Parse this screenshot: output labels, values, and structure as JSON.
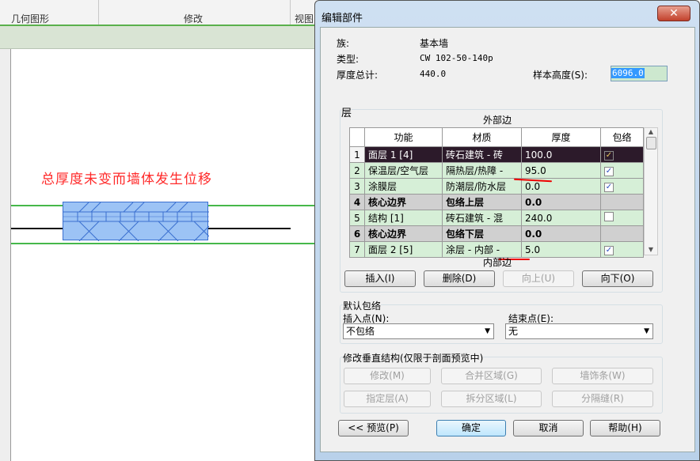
{
  "ribbon": {
    "panels": [
      "几何图形",
      "修改",
      "视图"
    ]
  },
  "canvas": {
    "annotation": "总厚度未变而墙体发生位移"
  },
  "dialog": {
    "title": "编辑部件",
    "close_icon": "close-icon",
    "family_label": "族:",
    "family_value": "基本墙",
    "type_label": "类型:",
    "type_value": "CW 102-50-140p",
    "total_label": "厚度总计:",
    "total_value": "440.0",
    "sample_label": "样本高度(S):",
    "sample_value": "6096.0",
    "layers_group": "层",
    "exterior": "外部边",
    "interior": "内部边",
    "columns": [
      "功能",
      "材质",
      "厚度",
      "包络"
    ],
    "rows": [
      {
        "n": "1",
        "func": "面层 1 [4]",
        "mat": "砖石建筑 - 砖",
        "thk": "100.0",
        "wrap": true
      },
      {
        "n": "2",
        "func": "保温层/空气层",
        "mat": "隔热层/热障 -",
        "thk": "95.0",
        "wrap": true
      },
      {
        "n": "3",
        "func": "涂膜层",
        "mat": "防潮层/防水层",
        "thk": "0.0",
        "wrap": true
      },
      {
        "n": "4",
        "func": "核心边界",
        "mat": "包络上层",
        "thk": "0.0",
        "wrap": null
      },
      {
        "n": "5",
        "func": "结构 [1]",
        "mat": "砖石建筑 - 混",
        "thk": "240.0",
        "wrap": false
      },
      {
        "n": "6",
        "func": "核心边界",
        "mat": "包络下层",
        "thk": "0.0",
        "wrap": null
      },
      {
        "n": "7",
        "func": "面层 2 [5]",
        "mat": "涂层 - 内部 -",
        "thk": "5.0",
        "wrap": true
      }
    ],
    "layer_buttons": {
      "insert": "插入(I)",
      "delete": "删除(D)",
      "up": "向上(U)",
      "down": "向下(O)"
    },
    "default_wrap": "默认包络",
    "insert_point_label": "插入点(N):",
    "insert_point_value": "不包络",
    "end_point_label": "结束点(E):",
    "end_point_value": "无",
    "vertical_group": "修改垂直结构(仅限于剖面预览中)",
    "vertical_buttons": {
      "modify": "修改(M)",
      "merge": "合并区域(G)",
      "sweep": "墙饰条(W)",
      "assign": "指定层(A)",
      "split": "拆分区域(L)",
      "reveal": "分隔缝(R)"
    },
    "footer": {
      "preview": "<< 预览(P)",
      "ok": "确定",
      "cancel": "取消",
      "help": "帮助(H)"
    }
  }
}
